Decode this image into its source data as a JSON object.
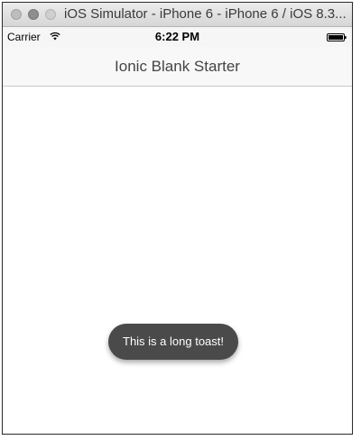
{
  "window": {
    "title": "iOS Simulator - iPhone 6 - iPhone 6 / iOS 8.3..."
  },
  "status_bar": {
    "carrier": "Carrier",
    "time": "6:22 PM",
    "wifi_icon": "wifi-icon",
    "battery_icon": "battery-icon"
  },
  "nav_bar": {
    "title": "Ionic Blank Starter"
  },
  "toast": {
    "message": "This is a long toast!"
  },
  "colors": {
    "toast_background": "#4a4a4a",
    "nav_background": "#f8f8f8"
  }
}
